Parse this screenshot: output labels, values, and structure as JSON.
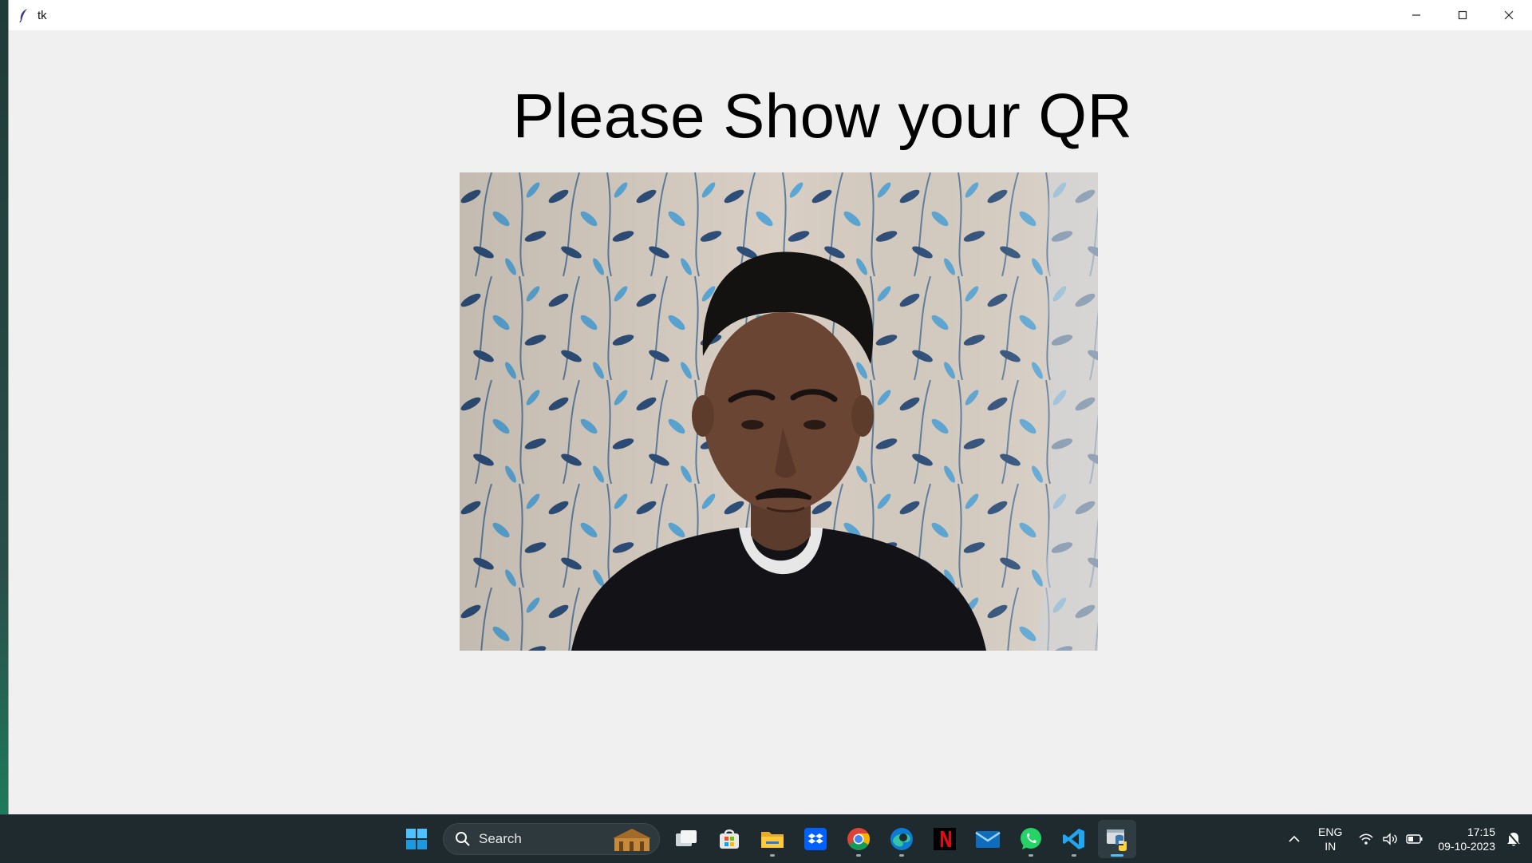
{
  "window": {
    "title": "tk",
    "controls": [
      "minimize-icon",
      "maximize-icon",
      "close-icon"
    ]
  },
  "app": {
    "heading": "Please Show your QR",
    "camera_feed": "webcam-preview"
  },
  "taskbar": {
    "search_label": "Search",
    "pinned": [
      "start-icon",
      "search",
      "task-view-icon",
      "microsoft-store-icon",
      "file-explorer-icon",
      "dropbox-icon",
      "chrome-icon",
      "edge-icon",
      "netflix-icon",
      "mail-icon",
      "whatsapp-icon",
      "vscode-icon",
      "python-icon"
    ],
    "active_app": "python-icon",
    "language_line1": "ENG",
    "language_line2": "IN",
    "time": "17:15",
    "date": "09-10-2023"
  },
  "colors": {
    "window_bg": "#f0f0f0",
    "taskbar_bg": "#1f2a2e",
    "accent": "#4cc2ff"
  }
}
